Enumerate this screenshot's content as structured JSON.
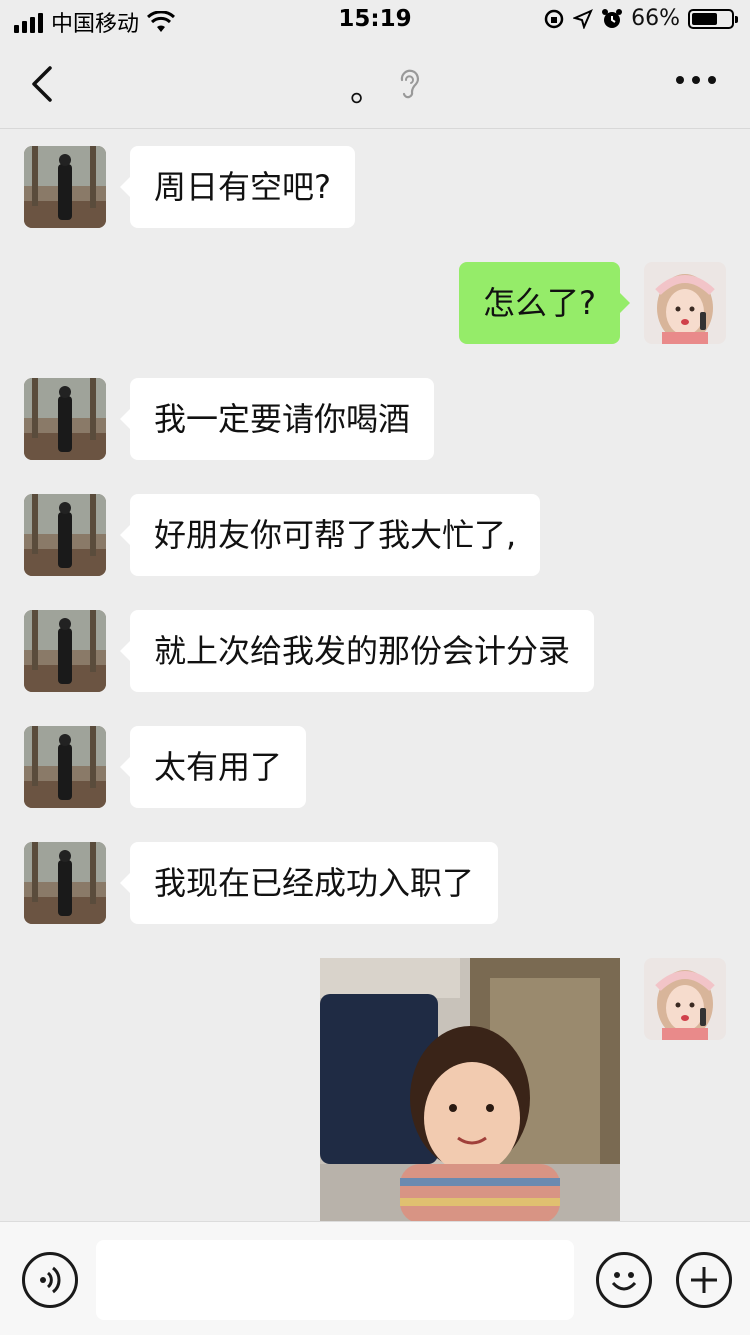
{
  "status_bar": {
    "carrier": "中国移动",
    "time": "15:19",
    "battery": "66%",
    "battery_level": 0.66,
    "icons": [
      "signal-icon",
      "wifi-icon",
      "orientation-lock-icon",
      "location-icon",
      "alarm-icon",
      "battery-icon"
    ]
  },
  "nav": {
    "back_icon": "chevron-left-icon",
    "title": "。",
    "ear_icon": "ear-icon",
    "more_icon": "more-dots-icon"
  },
  "messages": [
    {
      "side": "in",
      "text": "周日有空吧?"
    },
    {
      "side": "out",
      "text": "怎么了?"
    },
    {
      "side": "in",
      "text": "我一定要请你喝酒"
    },
    {
      "side": "in",
      "text": "好朋友你可帮了我大忙了,"
    },
    {
      "side": "in",
      "text": "就上次给我发的那份会计分录"
    },
    {
      "side": "in",
      "text": "太有用了"
    },
    {
      "side": "in",
      "text": "我现在已经成功入职了"
    },
    {
      "side": "out",
      "type": "image",
      "icon": "photo-sticker"
    }
  ],
  "input_bar": {
    "voice_icon": "voice-icon",
    "input_value": "",
    "emoji_icon": "emoji-icon",
    "plus_icon": "plus-icon"
  },
  "colors": {
    "background": "#ededed",
    "incoming_bubble": "#ffffff",
    "outgoing_bubble": "#95ec69",
    "input_bar": "#f7f7f7"
  }
}
